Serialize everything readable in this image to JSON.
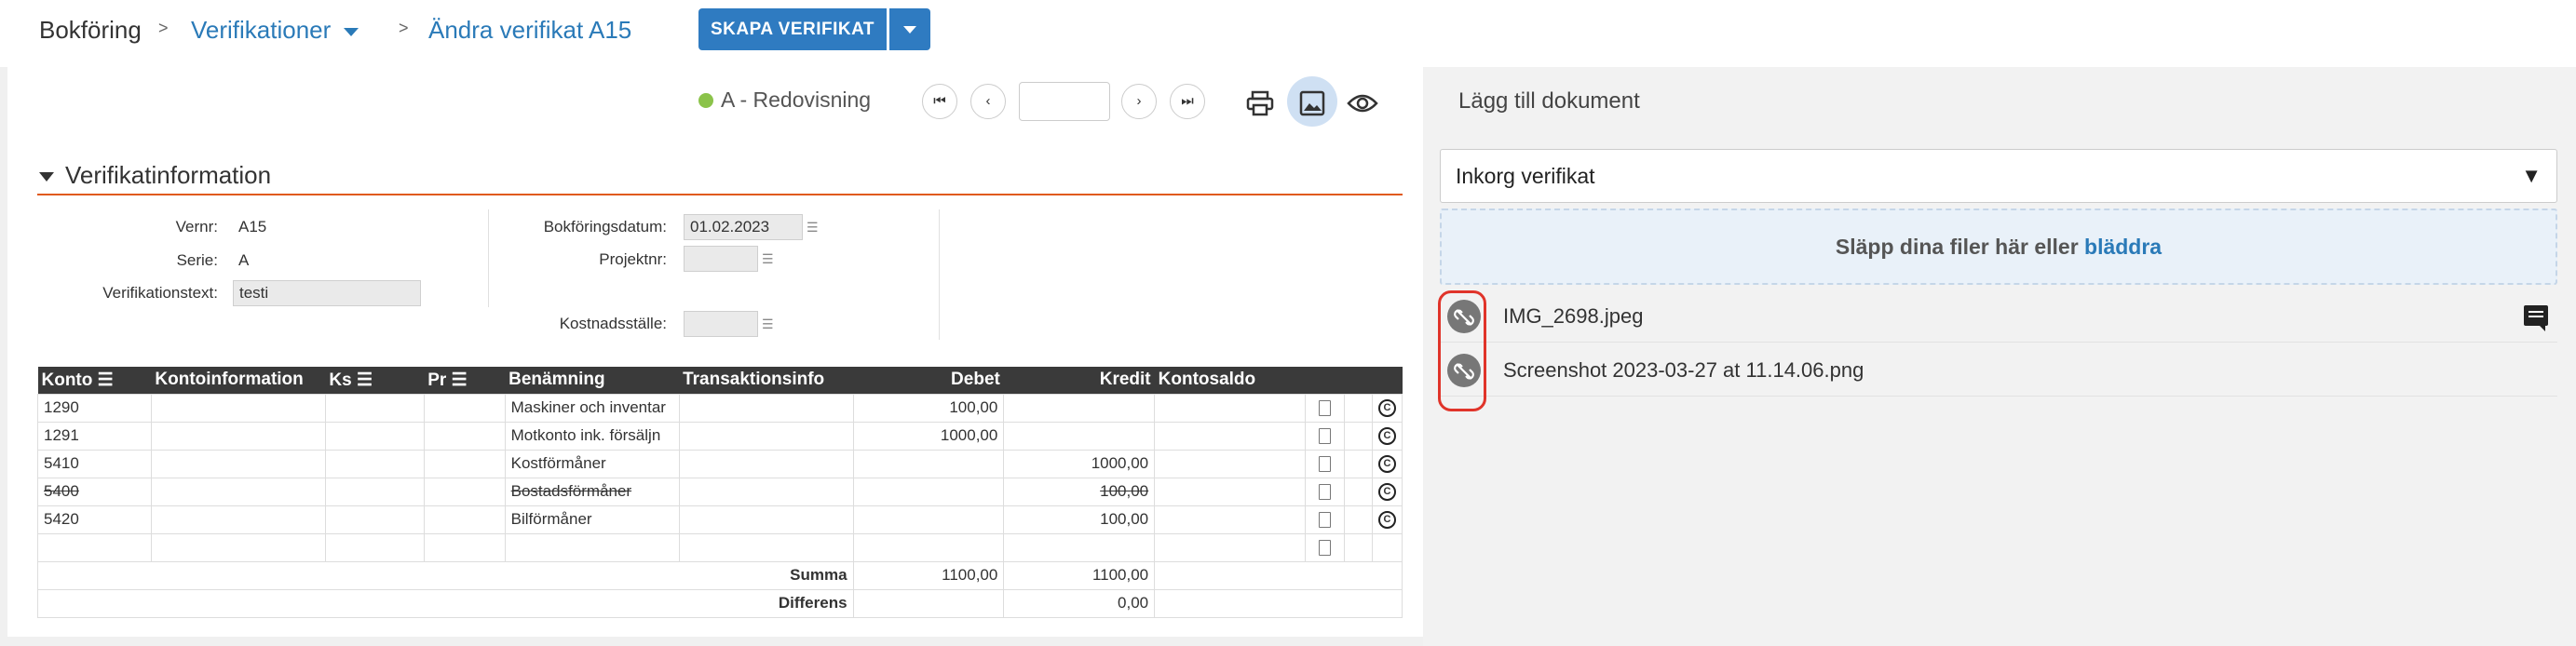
{
  "breadcrumb": {
    "home": "Bokföring",
    "section": "Verifikationer",
    "current": "Ändra verifikat A15",
    "sep": ">"
  },
  "toolbar": {
    "create_label": "SKAPA VERIFIKAT",
    "status_label": "A - Redovisning",
    "nav_first": "⏮",
    "nav_prev": "‹",
    "nav_next": "›",
    "nav_last": "⏭",
    "page_value": ""
  },
  "section": {
    "title": "Verifikatinformation"
  },
  "form": {
    "vernr_label": "Vernr:",
    "vernr_value": "A15",
    "serie_label": "Serie:",
    "serie_value": "A",
    "text_label": "Verifikationstext:",
    "text_value": "testi",
    "date_label": "Bokföringsdatum:",
    "date_value": "01.02.2023",
    "project_label": "Projektnr:",
    "project_value": "",
    "cost_label": "Kostnadsställe:",
    "cost_value": ""
  },
  "table": {
    "headers": [
      "Konto",
      "Kontoinformation",
      "Ks",
      "Pr",
      "Benämning",
      "Transaktionsinfo",
      "Debet",
      "Kredit",
      "Kontosaldo"
    ],
    "rows": [
      {
        "konto": "1290",
        "benamning": "Maskiner och inventar",
        "debet": "100,00",
        "kredit": "",
        "strike": false
      },
      {
        "konto": "1291",
        "benamning": "Motkonto ink. försäljn",
        "debet": "1000,00",
        "kredit": "",
        "strike": false
      },
      {
        "konto": "5410",
        "benamning": "Kostförmåner",
        "debet": "",
        "kredit": "1000,00",
        "strike": false
      },
      {
        "konto": "5400",
        "benamning": "Bostadsförmåner",
        "debet": "",
        "kredit": "100,00",
        "strike": true
      },
      {
        "konto": "5420",
        "benamning": "Bilförmåner",
        "debet": "",
        "kredit": "100,00",
        "strike": false
      }
    ],
    "summa_label": "Summa",
    "summa_debet": "1100,00",
    "summa_kredit": "1100,00",
    "diff_label": "Differens",
    "diff_value": "0,00"
  },
  "documents": {
    "title": "Lägg till dokument",
    "select_value": "Inkorg verifikat",
    "drop_text": "Släpp dina filer här eller",
    "drop_link": "bläddra",
    "files": [
      "IMG_2698.jpeg",
      "Screenshot 2023-03-27 at 11.14.06.png"
    ]
  },
  "colors": {
    "accent": "#2f7bc1",
    "section_line": "#e05a1e",
    "status_dot": "#8bc34a",
    "highlight": "#e0342a"
  }
}
